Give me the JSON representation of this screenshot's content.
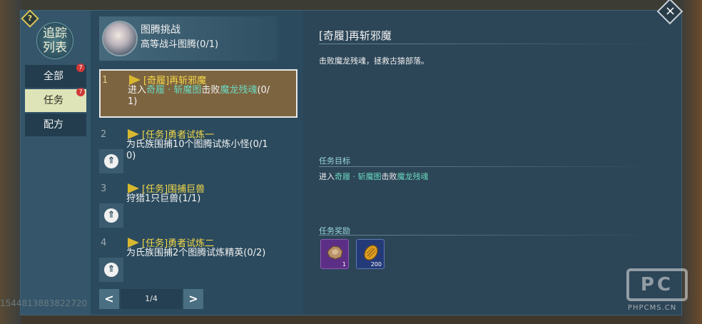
{
  "sidebar": {
    "help_label": "?",
    "title_line1": "追踪",
    "title_line2": "列表",
    "tabs": [
      {
        "label": "全部",
        "badge": "7",
        "active": false
      },
      {
        "label": "任务",
        "badge": "7",
        "active": true
      },
      {
        "label": "配方",
        "badge": "",
        "active": false
      }
    ]
  },
  "header": {
    "title": "图腾挑战",
    "subtitle": "高等战斗图腾(0/1)"
  },
  "quests": [
    {
      "num": "1",
      "title": "[奇履]再斩邪魔",
      "desc_prefix": "进入",
      "desc_hl1": "奇履 · 斩魔图",
      "desc_mid": "击败",
      "desc_hl2": "魔龙残魂",
      "desc_suffix": "(0/1)",
      "active": true
    },
    {
      "num": "2",
      "title": "[任务]勇者试炼一",
      "desc": "为氏族围捕10个图腾试炼小怪(0/10)",
      "active": false
    },
    {
      "num": "3",
      "title": "[任务]围捕巨兽",
      "desc": "狩猎1只巨兽(1/1)",
      "active": false
    },
    {
      "num": "4",
      "title": "[任务]勇者试炼二",
      "desc": "为氏族围捕2个图腾试炼精英(0/2)",
      "active": false
    }
  ],
  "up_icon": "⇑",
  "pager": {
    "prev": "<",
    "next": ">",
    "current": "1/4"
  },
  "detail": {
    "title": "[奇履]再斩邪魔",
    "description": "击败魔龙残魂，拯救古猿部落。",
    "goal_label": "任务目标",
    "goal_prefix": "进入",
    "goal_hl1": "奇履 · 斩魔图",
    "goal_mid": "击败",
    "goal_hl2": "魔龙残魂",
    "reward_label": "任务奖励",
    "rewards": [
      {
        "icon": "ore-icon",
        "count": "1",
        "rarity": "purple"
      },
      {
        "icon": "shell-icon",
        "count": "200",
        "rarity": "blue"
      }
    ]
  },
  "close_label": "×",
  "watermark": {
    "id": "1544813883822720",
    "logo": "PC",
    "site": "PHPCMS.CN"
  },
  "colors": {
    "panel": "#2c4557",
    "accent_yellow": "#f3d84a",
    "highlight_teal": "#6ad8c0",
    "active_quest": "#7d6440",
    "badge_red": "#d03838"
  }
}
